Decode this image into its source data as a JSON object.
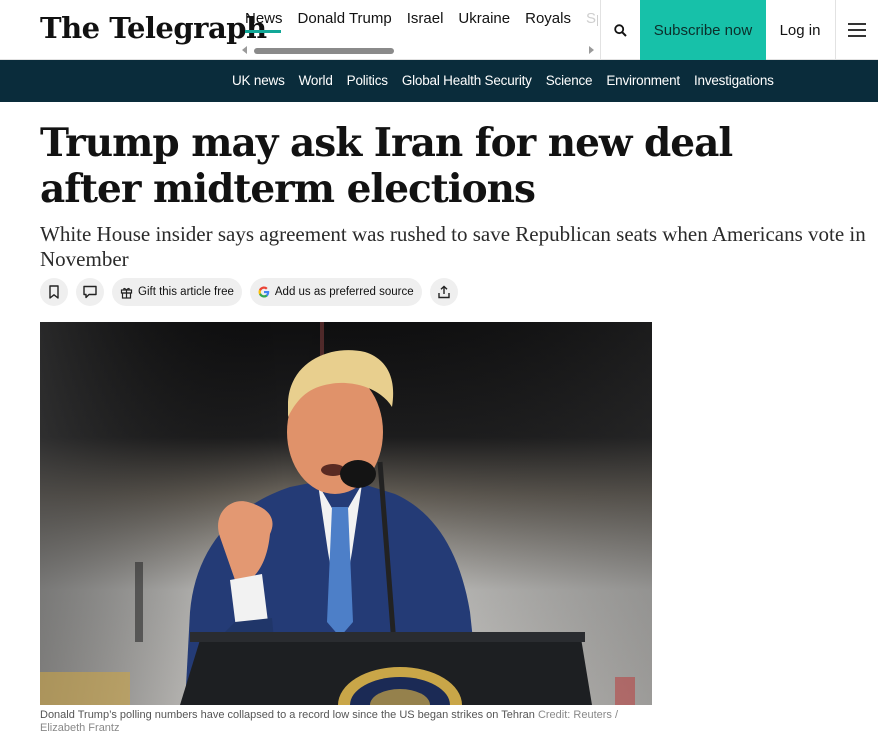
{
  "header": {
    "logo": "The Telegraph",
    "nav": [
      "News",
      "Donald Trump",
      "Israel",
      "Ukraine",
      "Royals",
      "Sp"
    ],
    "subscribe_label": "Subscribe now",
    "login_label": "Log in",
    "search_icon": "search-icon",
    "menu_icon": "hamburger-menu-icon",
    "accent_color": "#17c1a9"
  },
  "sections": [
    "UK news",
    "World",
    "Politics",
    "Global Health Security",
    "Science",
    "Environment",
    "Investigations"
  ],
  "article": {
    "headline": "Trump may ask Iran for new deal after midterm elections",
    "standfirst": "White House insider says agreement was rushed to save Republican seats when Americans vote in November",
    "actions": {
      "gift_label": "Gift this article free",
      "preferred_label": "Add us as preferred source"
    },
    "caption": "Donald Trump’s polling numbers have collapsed to a record low since the US began strikes on Tehran",
    "credit": "Credit: Reuters / Elizabeth Frantz"
  }
}
